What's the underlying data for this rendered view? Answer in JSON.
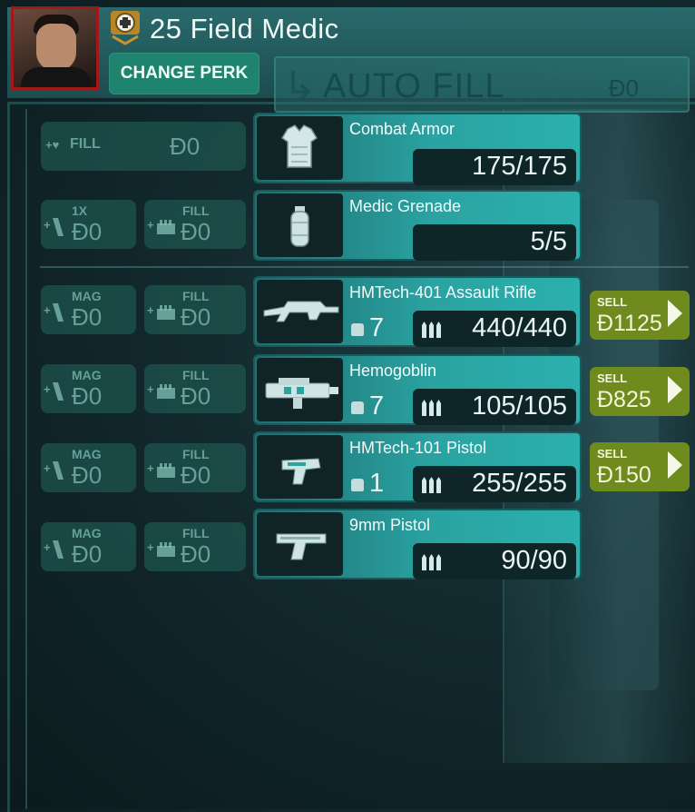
{
  "header": {
    "perk_level_title": "25 Field Medic",
    "change_perk_label": "CHANGE PERK",
    "autofill_label": "AUTO FILL",
    "autofill_cost": "Đ0"
  },
  "armor_row": {
    "fill_label": "FILL",
    "fill_cost": "Đ0",
    "item_name": "Combat Armor",
    "count": "175/175"
  },
  "grenade_row": {
    "qty_label": "1X",
    "qty_cost": "Đ0",
    "fill_label": "FILL",
    "fill_cost": "Đ0",
    "item_name": "Medic Grenade",
    "count": "5/5"
  },
  "weapons": [
    {
      "mag_label": "MAG",
      "mag_cost": "Đ0",
      "fill_label": "FILL",
      "fill_cost": "Đ0",
      "name": "HMTech-401 Assault Rifle",
      "weight": "7",
      "ammo": "440/440",
      "sell_label": "SELL",
      "sell_price": "Đ1125"
    },
    {
      "mag_label": "MAG",
      "mag_cost": "Đ0",
      "fill_label": "FILL",
      "fill_cost": "Đ0",
      "name": "Hemogoblin",
      "weight": "7",
      "ammo": "105/105",
      "sell_label": "SELL",
      "sell_price": "Đ825"
    },
    {
      "mag_label": "MAG",
      "mag_cost": "Đ0",
      "fill_label": "FILL",
      "fill_cost": "Đ0",
      "name": "HMTech-101 Pistol",
      "weight": "1",
      "ammo": "255/255",
      "sell_label": "SELL",
      "sell_price": "Đ150"
    },
    {
      "mag_label": "MAG",
      "mag_cost": "Đ0",
      "fill_label": "FILL",
      "fill_cost": "Đ0",
      "name": "9mm Pistol",
      "weight": "",
      "ammo": "90/90"
    }
  ],
  "icons": {
    "perk": "medic-perk-icon",
    "armor": "armor-vest-icon",
    "grenade": "grenade-icon",
    "rifle": "assault-rifle-icon",
    "hemogoblin": "medic-gun-icon",
    "pistol": "pistol-icon",
    "weight": "weight-icon",
    "ammo": "ammo-icon",
    "mag": "magazine-icon",
    "fill": "ammo-box-icon"
  },
  "colors": {
    "accent_teal": "#2aa3a2",
    "change_perk": "#1e8470",
    "sell_green": "#6f8b1e",
    "portrait_border": "#a01818"
  }
}
